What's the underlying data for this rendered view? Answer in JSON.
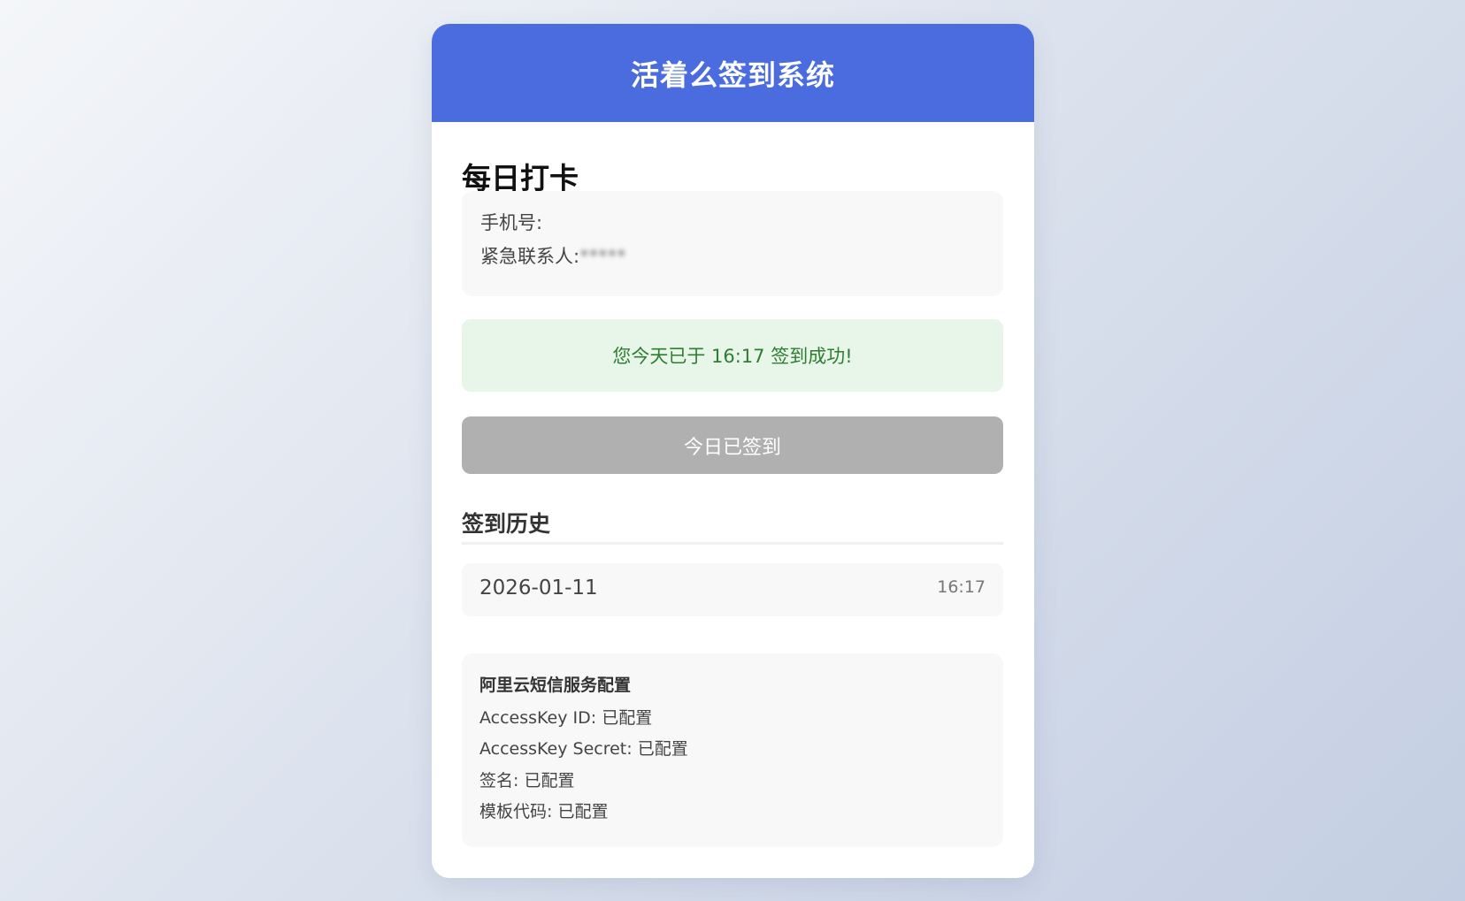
{
  "app": {
    "title": "活着么签到系统"
  },
  "checkin": {
    "section_title": "每日打卡",
    "phone_label": "手机号:",
    "contact_label": "紧急联系人:",
    "contact_value_redacted": "*****",
    "status_message": "您今天已于 16:17 签到成功!",
    "button_label": "今日已签到",
    "button_disabled": true
  },
  "history": {
    "title": "签到历史",
    "entries": [
      {
        "date": "2026-01-11",
        "time": "16:17"
      }
    ]
  },
  "sms_config": {
    "title": "阿里云短信服务配置",
    "items": [
      "AccessKey ID: 已配置",
      "AccessKey Secret: 已配置",
      "签名: 已配置",
      "模板代码: 已配置"
    ]
  },
  "colors": {
    "header_bg": "#4a6cdf",
    "success_bg": "#e7f6e8",
    "success_text": "#2e7d32",
    "disabled_button": "#b0b0b0"
  }
}
